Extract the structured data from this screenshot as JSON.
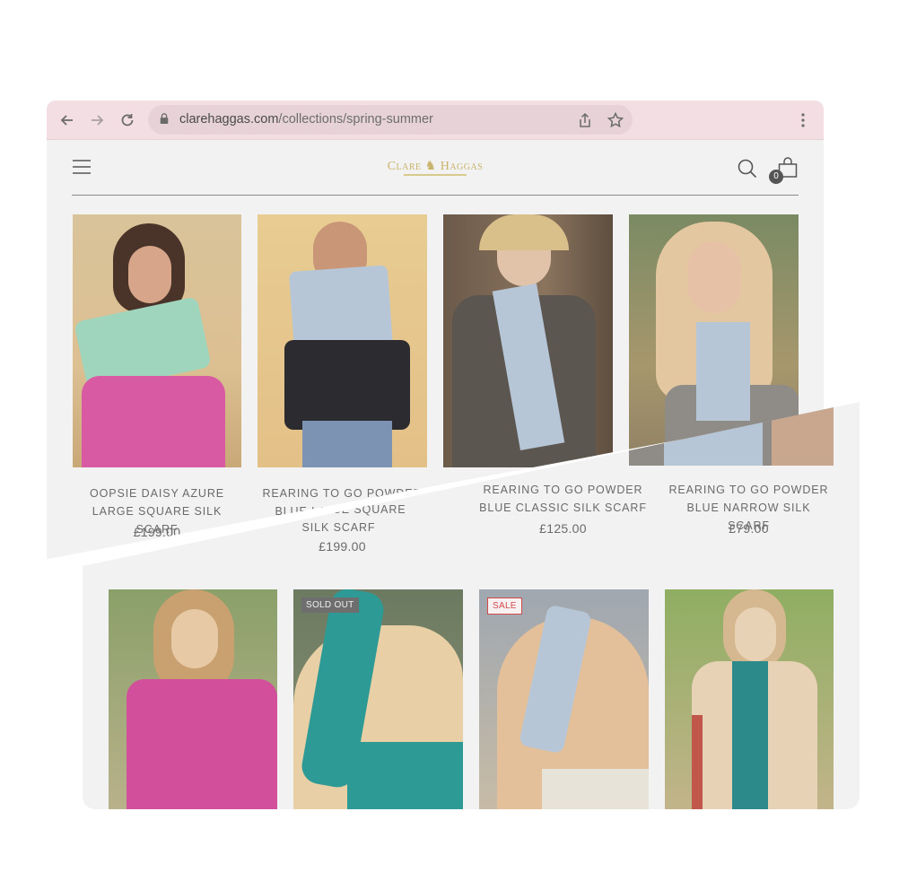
{
  "browser": {
    "url_domain": "clarehaggas.com",
    "url_path": "/collections/spring-summer",
    "icons": [
      "back-arrow-icon",
      "forward-arrow-icon",
      "reload-icon",
      "lock-icon",
      "share-icon",
      "star-icon",
      "kebab-menu-icon"
    ]
  },
  "header": {
    "logo_text": "Clare ♞ Haggas",
    "cart_count": "0",
    "icons": [
      "hamburger-menu-icon",
      "search-icon",
      "shopping-bag-icon"
    ]
  },
  "products_row1": [
    {
      "title": "OOPSIE DAISY AZURE LARGE SQUARE SILK SCARF",
      "price": "£199.00",
      "img_colors": [
        "#d9b98c",
        "#9fd4bd",
        "#d85aa2"
      ]
    },
    {
      "title": "REARING TO GO POWDER BLUE LARGE SQUARE SILK SCARF",
      "price": "£199.00",
      "img_colors": [
        "#e6c48a",
        "#b7c6d6",
        "#2c2c30"
      ]
    },
    {
      "title": "REARING TO GO POWDER BLUE CLASSIC SILK SCARF",
      "price": "£125.00",
      "img_colors": [
        "#6c5a4a",
        "#b7c6d6",
        "#5b5650"
      ]
    },
    {
      "title": "REARING TO GO POWDER BLUE NARROW SILK SCARF",
      "price": "£79.00",
      "img_colors": [
        "#7a8a63",
        "#e3c7a0",
        "#b7c6d6"
      ]
    }
  ],
  "products_row2": [
    {
      "badge": "",
      "img_colors": [
        "#8aa06a",
        "#e7c9a5",
        "#d2509b"
      ]
    },
    {
      "badge": "SOLD OUT",
      "img_colors": [
        "#6b7a60",
        "#2e9a95",
        "#e8cfa5"
      ]
    },
    {
      "badge": "SALE",
      "img_colors": [
        "#9fa7b0",
        "#b7c6d6",
        "#e3c09a"
      ]
    },
    {
      "badge": "",
      "img_colors": [
        "#8fae62",
        "#2c8b8a",
        "#e8d2b6"
      ]
    }
  ],
  "colors": {
    "toolbar_bg": "#f3dfe3",
    "page_bg": "#f2f2f2",
    "logo_gold": "#c9b36a",
    "sale_red": "#d24a4a"
  }
}
